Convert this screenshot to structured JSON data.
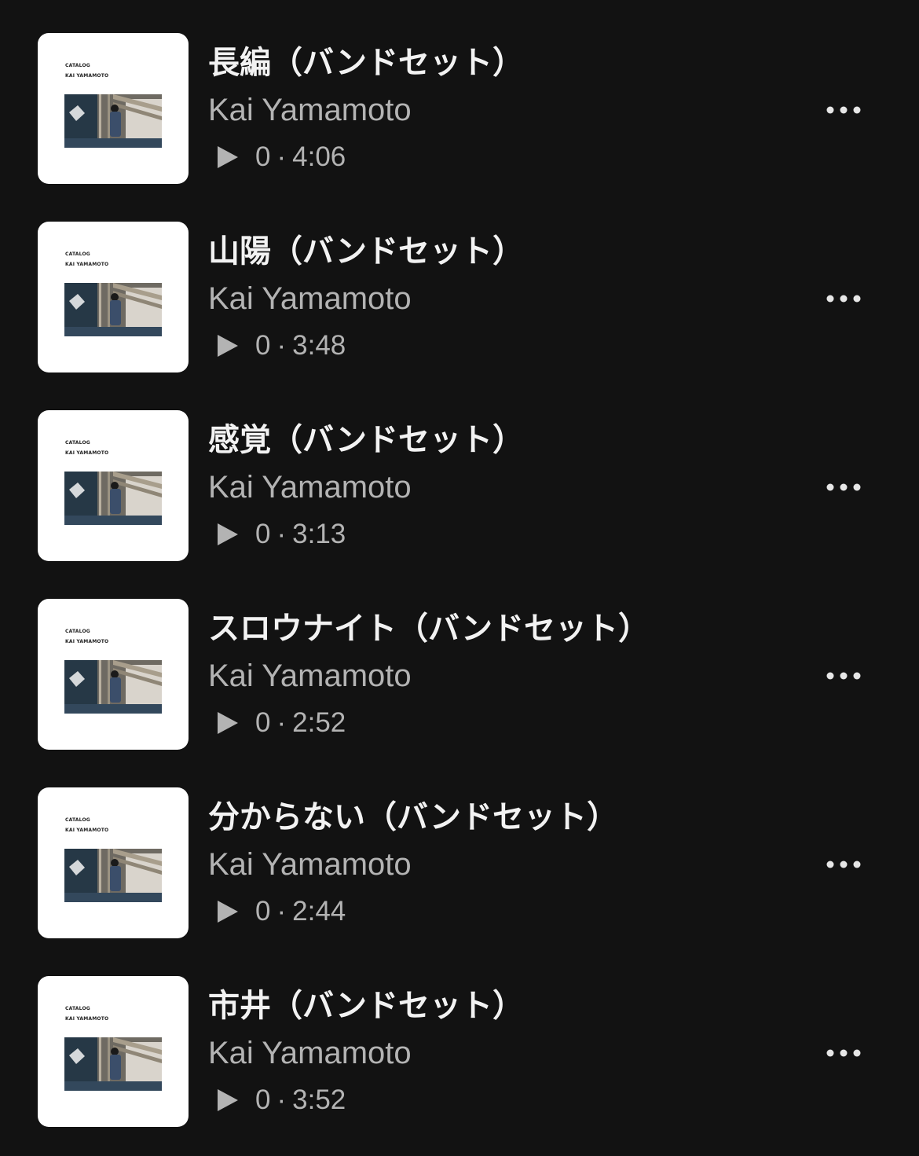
{
  "album": {
    "cover_text_line1": "CATALOG",
    "cover_text_line2": "KAI YAMAMOTO"
  },
  "tracks": [
    {
      "title": "長編（バンドセット）",
      "artist": "Kai Yamamoto",
      "plays": "0",
      "separator": "·",
      "duration": "4:06"
    },
    {
      "title": "山陽（バンドセット）",
      "artist": "Kai Yamamoto",
      "plays": "0",
      "separator": "·",
      "duration": "3:48"
    },
    {
      "title": "感覚（バンドセット）",
      "artist": "Kai Yamamoto",
      "plays": "0",
      "separator": "·",
      "duration": "3:13"
    },
    {
      "title": "スロウナイト（バンドセット）",
      "artist": "Kai Yamamoto",
      "plays": "0",
      "separator": "·",
      "duration": "2:52"
    },
    {
      "title": "分からない（バンドセット）",
      "artist": "Kai Yamamoto",
      "plays": "0",
      "separator": "·",
      "duration": "2:44"
    },
    {
      "title": "市井（バンドセット）",
      "artist": "Kai Yamamoto",
      "plays": "0",
      "separator": "·",
      "duration": "3:52"
    }
  ],
  "icons": {
    "play": "play-icon",
    "more": "more-options-icon"
  },
  "colors": {
    "background": "#121212",
    "title": "#f2f2f2",
    "secondary": "#b3b3b3",
    "artwork_bg": "#ffffff"
  }
}
